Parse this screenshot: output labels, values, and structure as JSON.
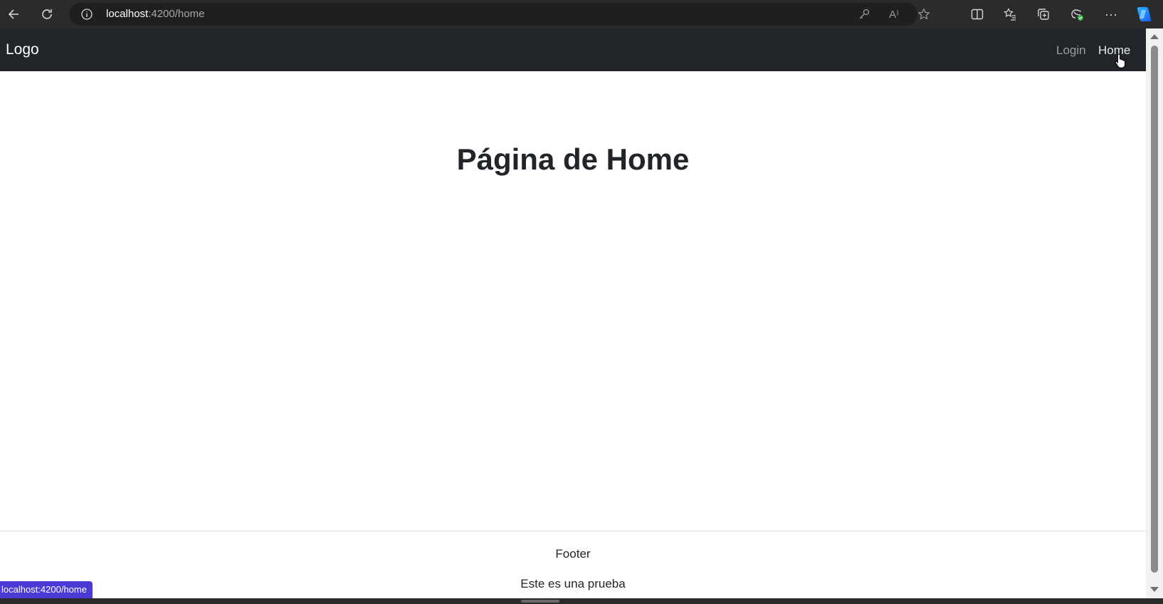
{
  "browser": {
    "url_host": "localhost",
    "url_path": ":4200/home",
    "icons": [
      "back-arrow-icon",
      "refresh-icon",
      "site-info-icon",
      "key-icon",
      "read-aloud-icon",
      "favorite-star-icon",
      "split-screen-icon",
      "favorites-list-icon",
      "collections-icon",
      "browser-essentials-icon",
      "more-options-icon",
      "copilot-icon"
    ],
    "read_aloud_glyph": "A⁾",
    "more_glyph": "···"
  },
  "navbar": {
    "brand": "Logo",
    "links": [
      {
        "label": "Login",
        "active": false
      },
      {
        "label": "Home",
        "active": true
      }
    ]
  },
  "main": {
    "title": "Página de Home"
  },
  "footer": {
    "heading": "Footer",
    "text": "Este es una prueba"
  },
  "status_bar": {
    "link_preview": "localhost:4200/home"
  },
  "colors": {
    "navbar_bg": "#212529",
    "browser_bg": "#2b2b2b",
    "status_bg": "#4b3bd6"
  }
}
